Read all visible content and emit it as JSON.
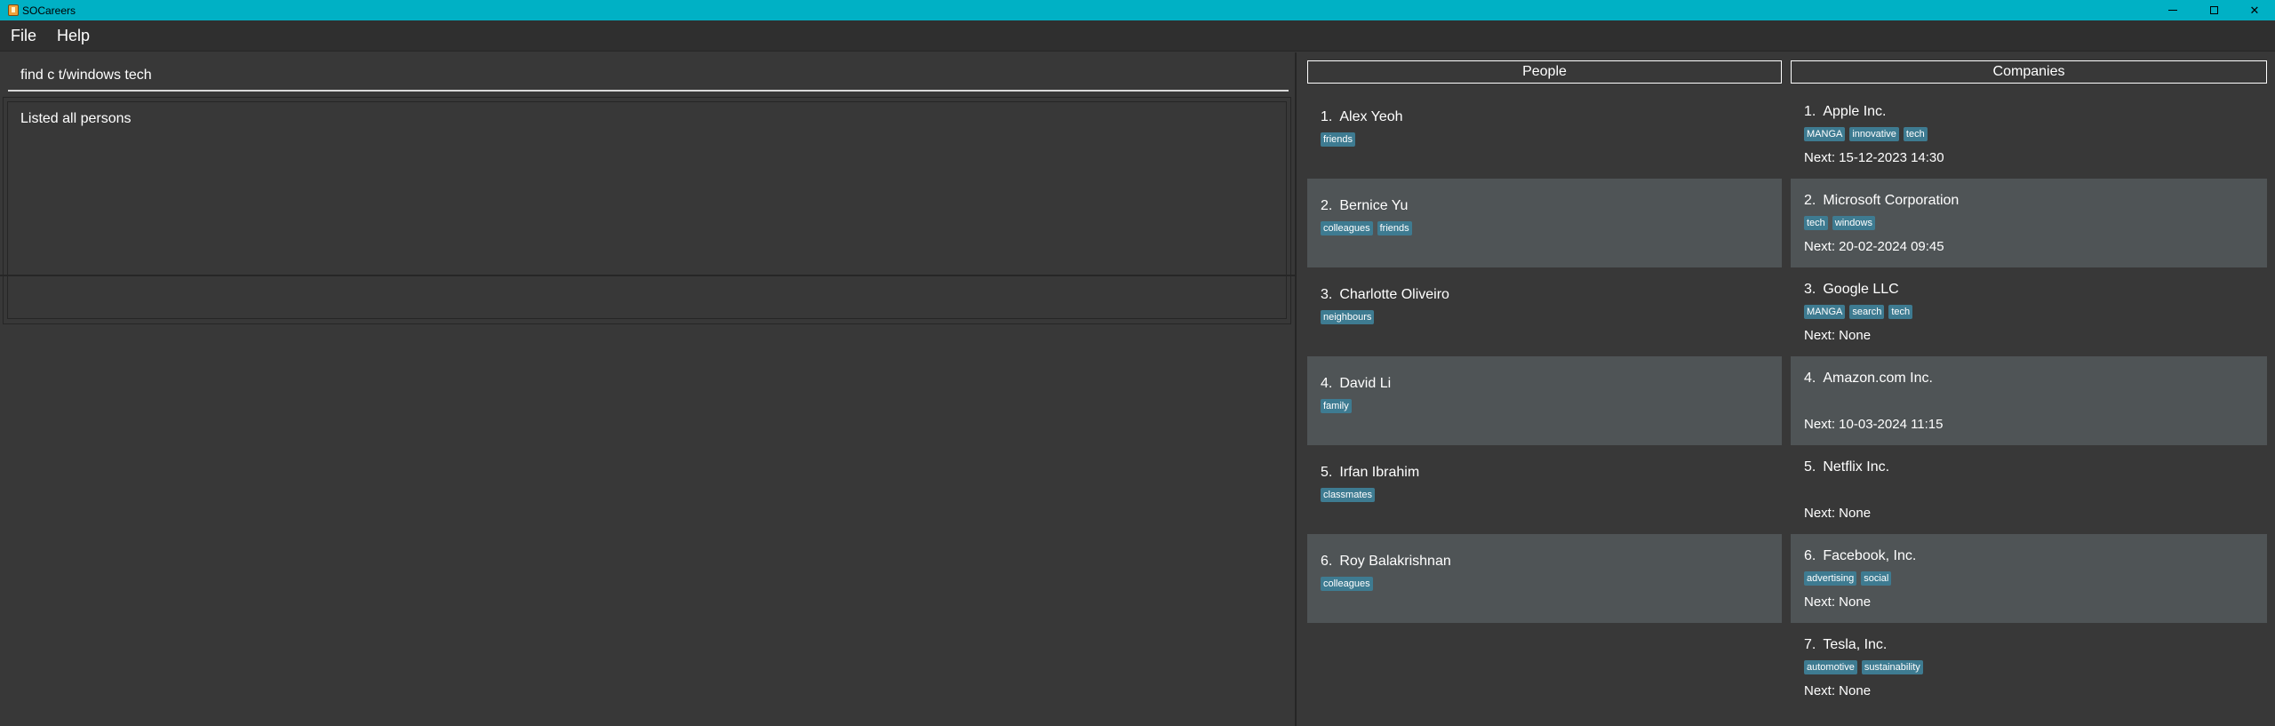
{
  "window": {
    "title": "SOCareers",
    "controls": {
      "minimize": "–",
      "maximize": "☐",
      "close": "✕"
    }
  },
  "menu": [
    "File",
    "Help"
  ],
  "command": {
    "value": "find c t/windows tech"
  },
  "result": {
    "text": "Listed all persons"
  },
  "people": {
    "header": "People",
    "items": [
      {
        "index": "1.",
        "name": "Alex Yeoh",
        "tags": [
          "friends"
        ]
      },
      {
        "index": "2.",
        "name": "Bernice Yu",
        "tags": [
          "colleagues",
          "friends"
        ]
      },
      {
        "index": "3.",
        "name": "Charlotte Oliveiro",
        "tags": [
          "neighbours"
        ]
      },
      {
        "index": "4.",
        "name": "David Li",
        "tags": [
          "family"
        ]
      },
      {
        "index": "5.",
        "name": "Irfan Ibrahim",
        "tags": [
          "classmates"
        ]
      },
      {
        "index": "6.",
        "name": "Roy Balakrishnan",
        "tags": [
          "colleagues"
        ]
      }
    ]
  },
  "companies": {
    "header": "Companies",
    "items": [
      {
        "index": "1.",
        "name": "Apple Inc.",
        "tags": [
          "MANGA",
          "innovative",
          "tech"
        ],
        "next": "Next: 15-12-2023 14:30"
      },
      {
        "index": "2.",
        "name": "Microsoft Corporation",
        "tags": [
          "tech",
          "windows"
        ],
        "next": "Next: 20-02-2024 09:45"
      },
      {
        "index": "3.",
        "name": "Google LLC",
        "tags": [
          "MANGA",
          "search",
          "tech"
        ],
        "next": "Next: None"
      },
      {
        "index": "4.",
        "name": "Amazon.com Inc.",
        "tags": [],
        "next": "Next: 10-03-2024 11:15"
      },
      {
        "index": "5.",
        "name": "Netflix Inc.",
        "tags": [],
        "next": "Next: None"
      },
      {
        "index": "6.",
        "name": "Facebook, Inc.",
        "tags": [
          "advertising",
          "social"
        ],
        "next": "Next: None"
      },
      {
        "index": "7.",
        "name": "Tesla, Inc.",
        "tags": [
          "automotive",
          "sustainability"
        ],
        "next": "Next: None"
      }
    ]
  },
  "colors": {
    "titlebar": "#00b1c5",
    "background": "#383838",
    "alt_row": "#4f5456",
    "tag": "#3e7b91"
  }
}
